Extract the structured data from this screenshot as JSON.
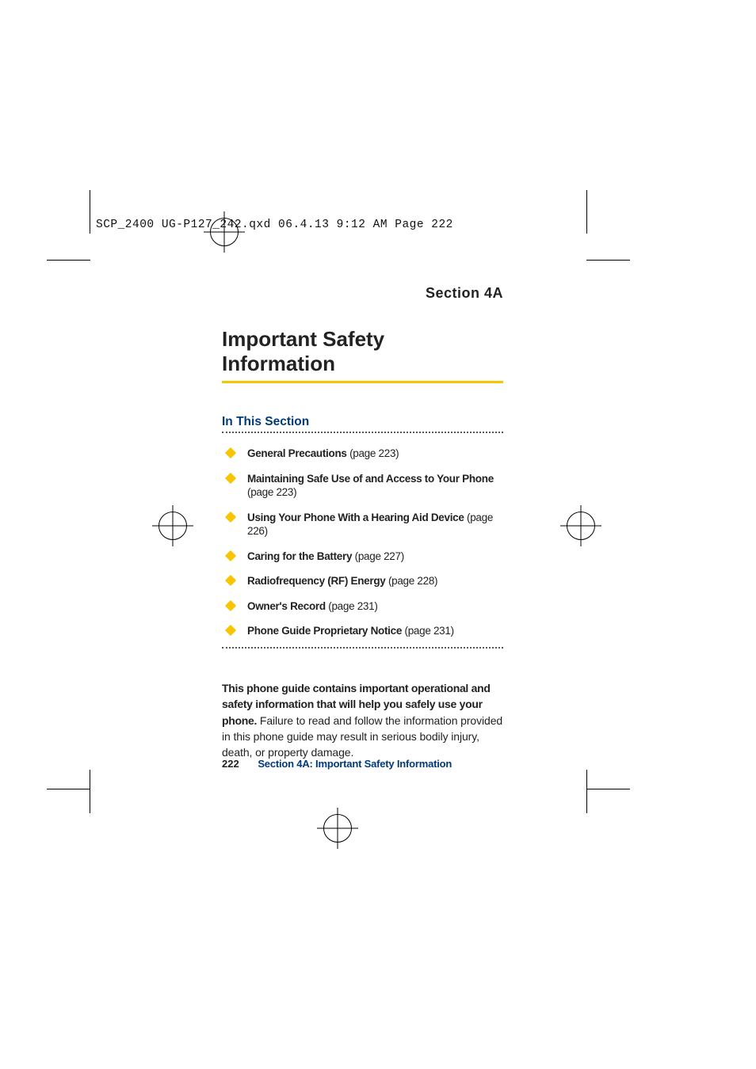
{
  "slug": "SCP_2400 UG-P127_242.qxd  06.4.13  9:12 AM  Page 222",
  "section_label": "Section 4A",
  "title": "Important Safety Information",
  "in_this_section": "In This Section",
  "toc": [
    {
      "label": "General Precautions",
      "page": "(page 223)"
    },
    {
      "label": "Maintaining Safe Use of and Access to Your Phone",
      "page": "(page 223)"
    },
    {
      "label": "Using Your Phone With a Hearing Aid Device",
      "page": "(page 226)"
    },
    {
      "label": "Caring for the Battery",
      "page": "(page 227)"
    },
    {
      "label": "Radiofrequency (RF) Energy",
      "page": "(page 228)"
    },
    {
      "label": "Owner's Record",
      "page": "(page 231)"
    },
    {
      "label": "Phone Guide Proprietary Notice",
      "page": "(page 231)"
    }
  ],
  "paragraph_bold": "This phone guide contains important operational and safety information that will help you safely use your phone.",
  "paragraph_rest": " Failure to read and follow the information provided in this phone guide may result in serious bodily injury, death, or property damage.",
  "footer_page": "222",
  "footer_text": "Section 4A: Important Safety Information"
}
